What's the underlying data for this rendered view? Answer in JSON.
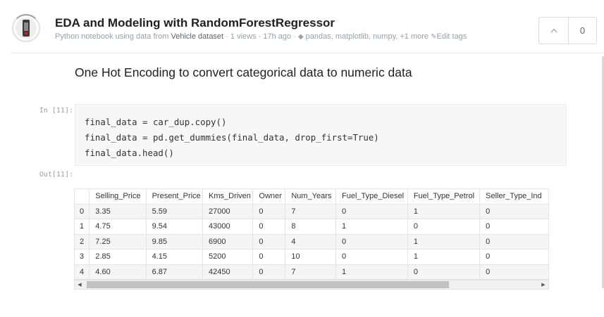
{
  "notebook": {
    "title": "EDA and Modeling with RandomForestRegressor",
    "meta_prefix": "Python notebook using data from ",
    "dataset_name": "Vehicle dataset",
    "meta_views": " · 1 views · 17h ago · ",
    "tags": "pandas, matplotlib, numpy, +1 more",
    "edit_tags": "Edit tags",
    "vote_count": "0"
  },
  "markdown": {
    "heading": "One Hot Encoding to convert categorical data to numeric data"
  },
  "cell": {
    "in_prompt": "In [11]:",
    "out_prompt": "Out[11]:",
    "code": [
      "final_data = car_dup.copy()",
      "final_data = pd.get_dummies(final_data, drop_first=True)",
      "final_data.head()"
    ]
  },
  "dataframe": {
    "columns": [
      "",
      "Selling_Price",
      "Present_Price",
      "Kms_Driven",
      "Owner",
      "Num_Years",
      "Fuel_Type_Diesel",
      "Fuel_Type_Petrol",
      "Seller_Type_Ind"
    ],
    "rows": [
      [
        "0",
        "3.35",
        "5.59",
        "27000",
        "0",
        "7",
        "0",
        "1",
        "0"
      ],
      [
        "1",
        "4.75",
        "9.54",
        "43000",
        "0",
        "8",
        "1",
        "0",
        "0"
      ],
      [
        "2",
        "7.25",
        "9.85",
        "6900",
        "0",
        "4",
        "0",
        "1",
        "0"
      ],
      [
        "3",
        "2.85",
        "4.15",
        "5200",
        "0",
        "10",
        "0",
        "1",
        "0"
      ],
      [
        "4",
        "4.60",
        "6.87",
        "42450",
        "0",
        "7",
        "1",
        "0",
        "0"
      ]
    ]
  },
  "icons": {
    "tag": "tag-icon",
    "pencil": "pencil-icon",
    "upvote": "chevron-up-icon",
    "scroll_left": "triangle-left-icon",
    "scroll_right": "triangle-right-icon"
  }
}
